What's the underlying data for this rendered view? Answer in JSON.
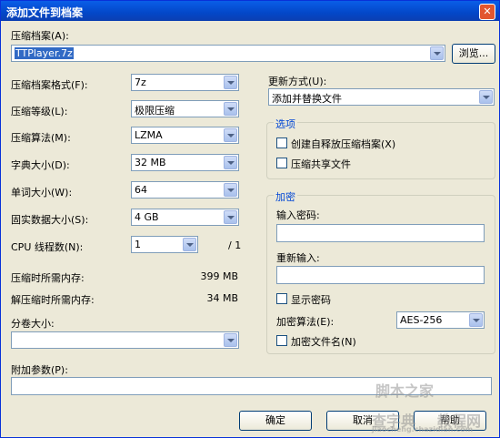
{
  "window": {
    "title": "添加文件到档案",
    "close_glyph": "✕"
  },
  "archive": {
    "label": "压缩档案(A):",
    "value": "TTPlayer.7z",
    "browse": "浏览..."
  },
  "format": {
    "label": "压缩档案格式(F):",
    "value": "7z"
  },
  "level": {
    "label": "压缩等级(L):",
    "value": "极限压缩"
  },
  "method": {
    "label": "压缩算法(M):",
    "value": "LZMA"
  },
  "dict": {
    "label": "字典大小(D):",
    "value": "32 MB"
  },
  "word": {
    "label": "单词大小(W):",
    "value": "64"
  },
  "solid": {
    "label": "固实数据大小(S):",
    "value": "4 GB"
  },
  "cpu": {
    "label": "CPU 线程数(N):",
    "value": "1",
    "suffix": "/ 1"
  },
  "mem_compress": {
    "label": "压缩时所需内存:",
    "value": "399 MB"
  },
  "mem_decompress": {
    "label": "解压缩时所需内存:",
    "value": "34 MB"
  },
  "volume": {
    "label": "分卷大小:",
    "value": ""
  },
  "params": {
    "label": "附加参数(P):",
    "value": ""
  },
  "update": {
    "label": "更新方式(U):",
    "value": "添加并替换文件"
  },
  "options": {
    "title": "选项",
    "sfx": "创建自释放压缩档案(X)",
    "shared": "压缩共享文件"
  },
  "encryption": {
    "title": "加密",
    "pw_label": "输入密码:",
    "pw_value": "",
    "re_label": "重新输入:",
    "re_value": "",
    "show_pw": "显示密码",
    "method_label": "加密算法(E):",
    "method_value": "AES-256",
    "encrypt_names": "加密文件名(N)"
  },
  "buttons": {
    "ok": "确定",
    "cancel": "取消",
    "help": "帮助"
  },
  "watermark": {
    "top": "脚本之家",
    "mid": "查字典",
    "site": "教程网",
    "url": "jiaocheng.chazidian.com"
  }
}
